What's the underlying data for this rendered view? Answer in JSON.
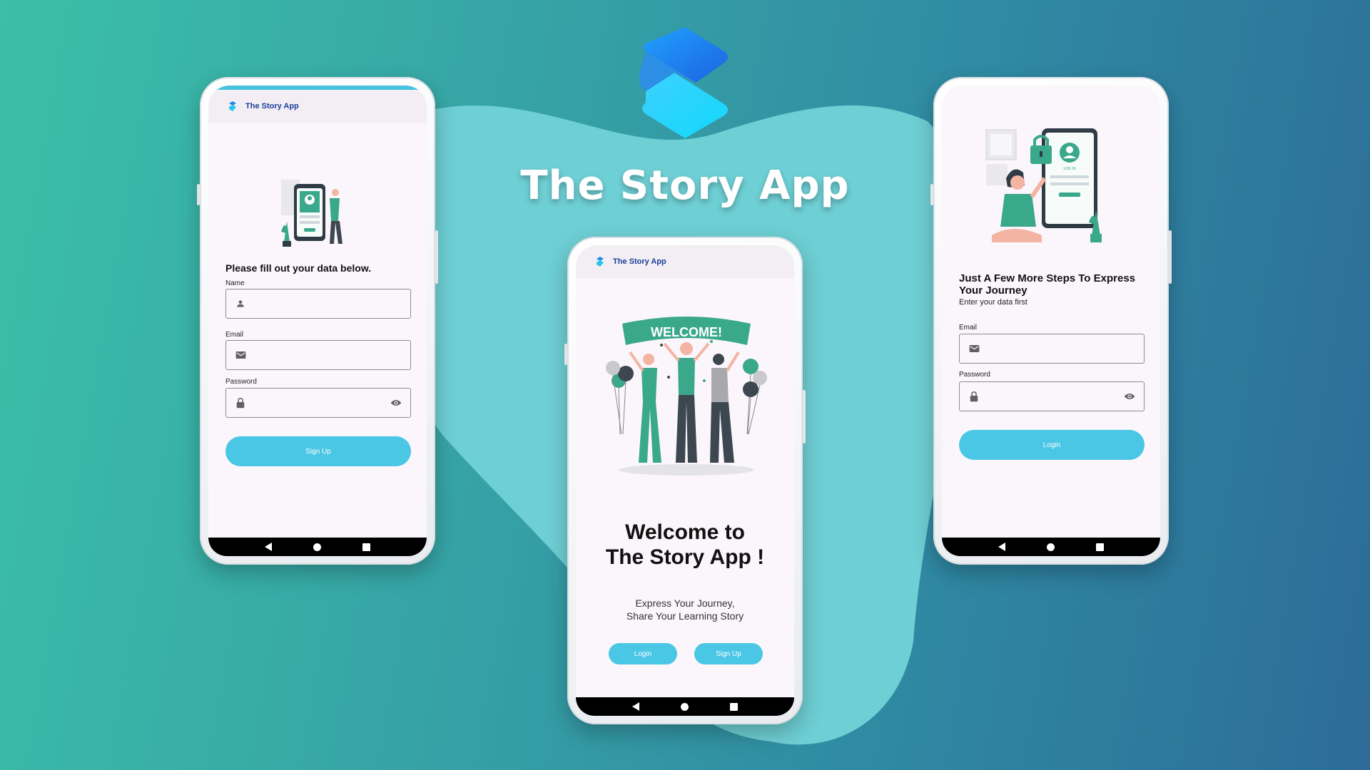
{
  "hero": {
    "title": "The Story App",
    "logo": "story-app-logo-icon"
  },
  "colors": {
    "bg_start": "#3bbfa8",
    "bg_end": "#2d6c98",
    "blob": "#6ecfd4",
    "accent_button": "#4ac7e5",
    "app_title": "#1d3e9c",
    "screen": "#fbf6fb",
    "illustration_green": "#3aa88a"
  },
  "signup_screen": {
    "app_title": "The Story App",
    "heading": "Please fill out your data below.",
    "name_label": "Name",
    "name_value": "",
    "email_label": "Email",
    "email_value": "",
    "password_label": "Password",
    "password_value": "",
    "signup_button": "Sign Up",
    "illustration": "phone-welcome-illustration",
    "icons": [
      "person-icon",
      "mail-icon",
      "lock-icon",
      "eye-icon"
    ]
  },
  "welcome_screen": {
    "app_title": "The Story App",
    "banner_text": "WELCOME!",
    "title_line1": "Welcome to",
    "title_line2": "The Story App !",
    "subtitle_line1": "Express Your Journey,",
    "subtitle_line2": "Share Your Learning Story",
    "login_button": "Login",
    "signup_button": "Sign Up",
    "illustration": "people-celebrating-welcome-illustration"
  },
  "login_screen": {
    "heading": "Just A Few More Steps To Express Your Journey",
    "subheading": "Enter your data first",
    "email_label": "Email",
    "email_value": "",
    "password_label": "Password",
    "password_value": "",
    "login_button": "Login",
    "illustration": "login-security-illustration",
    "illustration_text": "LOG IN"
  },
  "nav_bar": {
    "back": "back-icon",
    "home": "home-icon",
    "recents": "recents-icon"
  }
}
